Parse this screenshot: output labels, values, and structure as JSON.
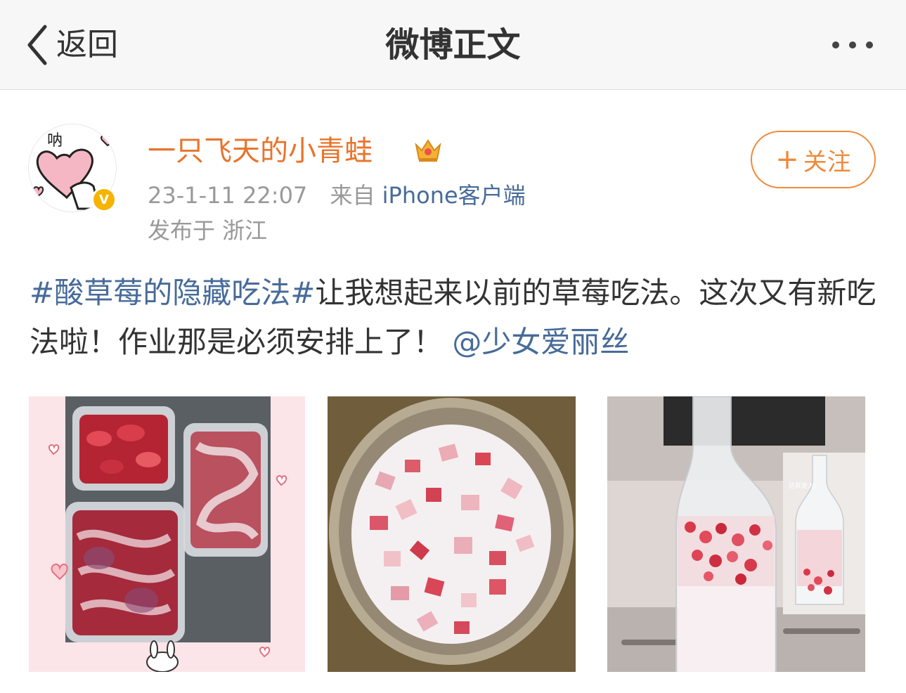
{
  "navbar": {
    "back_label": "返回",
    "title": "微博正文",
    "icons": {
      "back": "chevron-left-icon",
      "more": "more-dots-icon"
    }
  },
  "author": {
    "name": "一只飞天的小青蛙",
    "avatar_text": "呐",
    "verified_badge": "V",
    "time": "23-1-11 22:07",
    "source_prefix": "来自",
    "source_client": "iPhone客户端",
    "location": "发布于 浙江",
    "follow_label": "关注",
    "follow_plus": "+"
  },
  "post": {
    "topic": "#酸草莓的隐藏吃法#",
    "body": "让我想起来以前的草莓吃法。这次又有新吃法啦！作业那是必须安排上了！",
    "mention": "@少女爱丽丝"
  },
  "photos": [
    {
      "id": "photo-1",
      "caption": ""
    },
    {
      "id": "photo-2",
      "caption": ""
    },
    {
      "id": "photo-3",
      "overlay_text": "这就是大!"
    }
  ],
  "colors": {
    "username": "#e8742c",
    "link": "#476b99",
    "meta": "#999999",
    "follow": "#f08a3c",
    "navbar_bg": "#f7f7f7"
  }
}
